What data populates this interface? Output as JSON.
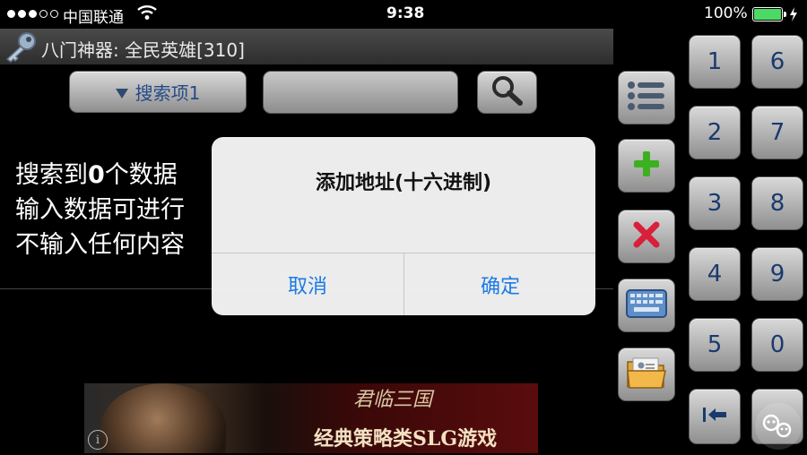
{
  "status_bar": {
    "carrier": "中国联通",
    "time": "9:38",
    "battery": "100%",
    "battery_level": 1.0,
    "signal_icon": "signal-dots-icon",
    "wifi_icon": "wifi-icon"
  },
  "title_bar": {
    "title": "八门神器: 全民英雄[310]",
    "icon": "key-icon"
  },
  "search_bar": {
    "dropdown_label": "搜索项1",
    "input_value": "",
    "search_icon": "magnifier-icon"
  },
  "results": {
    "line1_prefix": "搜索到",
    "line1_count": "0",
    "line1_suffix": "个数据",
    "line2": "输入数据可进行",
    "line3": "不输入任何内容"
  },
  "dialog": {
    "title": "添加地址(十六进制)",
    "cancel_label": "取消",
    "confirm_label": "确定"
  },
  "toolbar": {
    "list_icon": "list-icon",
    "add_icon": "plus-icon",
    "delete_icon": "cross-icon",
    "keyboard_icon": "keyboard-icon",
    "folder_icon": "folder-icon"
  },
  "keypad": {
    "keys": [
      "1",
      "6",
      "2",
      "7",
      "3",
      "8",
      "4",
      "9",
      "5",
      "0"
    ],
    "backspace_icon": "backspace-arrow-icon"
  },
  "ad": {
    "logo": "君临三国",
    "slogan": "经典策略类SLG游戏",
    "info_icon": "info-icon"
  },
  "colors": {
    "key_text": "#1a3a6e",
    "dialog_button": "#1b7ae6",
    "battery": "#4cd964",
    "add_green": "#3cb01e",
    "delete_red": "#d8203a"
  }
}
